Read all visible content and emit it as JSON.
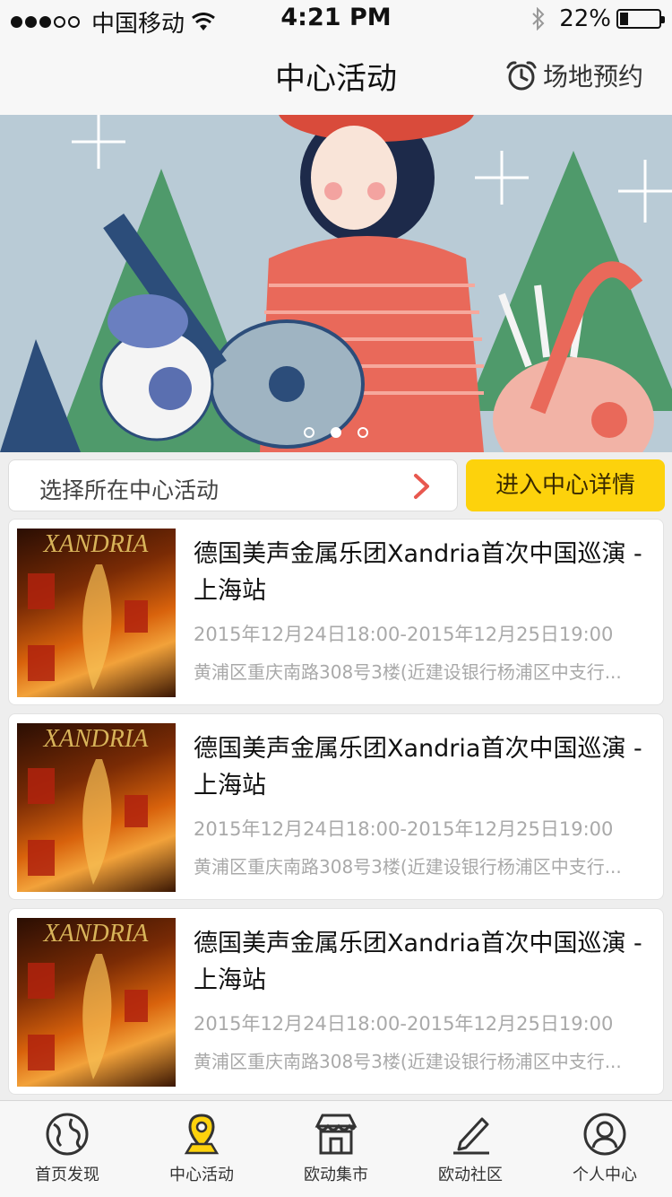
{
  "status_bar": {
    "carrier": "中国移动",
    "time": "4:21 PM",
    "battery_percent": "22%",
    "battery_level": 0.22
  },
  "nav": {
    "title": "中心活动",
    "action_label": "场地预约",
    "action_icon": "clock-icon"
  },
  "banner": {
    "page_count": 3,
    "active_page": 2
  },
  "selector": {
    "label": "选择所在中心活动",
    "button_label": "进入中心详情"
  },
  "colors": {
    "accent_yellow": "#fdd20c",
    "chevron_red": "#e8584f",
    "muted_text": "#a9a9a9"
  },
  "events": [
    {
      "title": "德国美声金属乐团Xandria首次中国巡演 - 上海站",
      "time": "2015年12月24日18:00-2015年12月25日19:00",
      "address": "黄浦区重庆南路308号3楼(近建设银行杨浦区中支行..."
    },
    {
      "title": "德国美声金属乐团Xandria首次中国巡演 - 上海站",
      "time": "2015年12月24日18:00-2015年12月25日19:00",
      "address": "黄浦区重庆南路308号3楼(近建设银行杨浦区中支行..."
    },
    {
      "title": "德国美声金属乐团Xandria首次中国巡演 - 上海站",
      "time": "2015年12月24日18:00-2015年12月25日19:00",
      "address": "黄浦区重庆南路308号3楼(近建设银行杨浦区中支行..."
    }
  ],
  "tabs": [
    {
      "label": "首页发现",
      "icon": "globe-icon"
    },
    {
      "label": "中心活动",
      "icon": "location-pin-icon",
      "active": true
    },
    {
      "label": "欧动集市",
      "icon": "store-icon"
    },
    {
      "label": "欧动社区",
      "icon": "pen-icon"
    },
    {
      "label": "个人中心",
      "icon": "user-icon"
    }
  ]
}
